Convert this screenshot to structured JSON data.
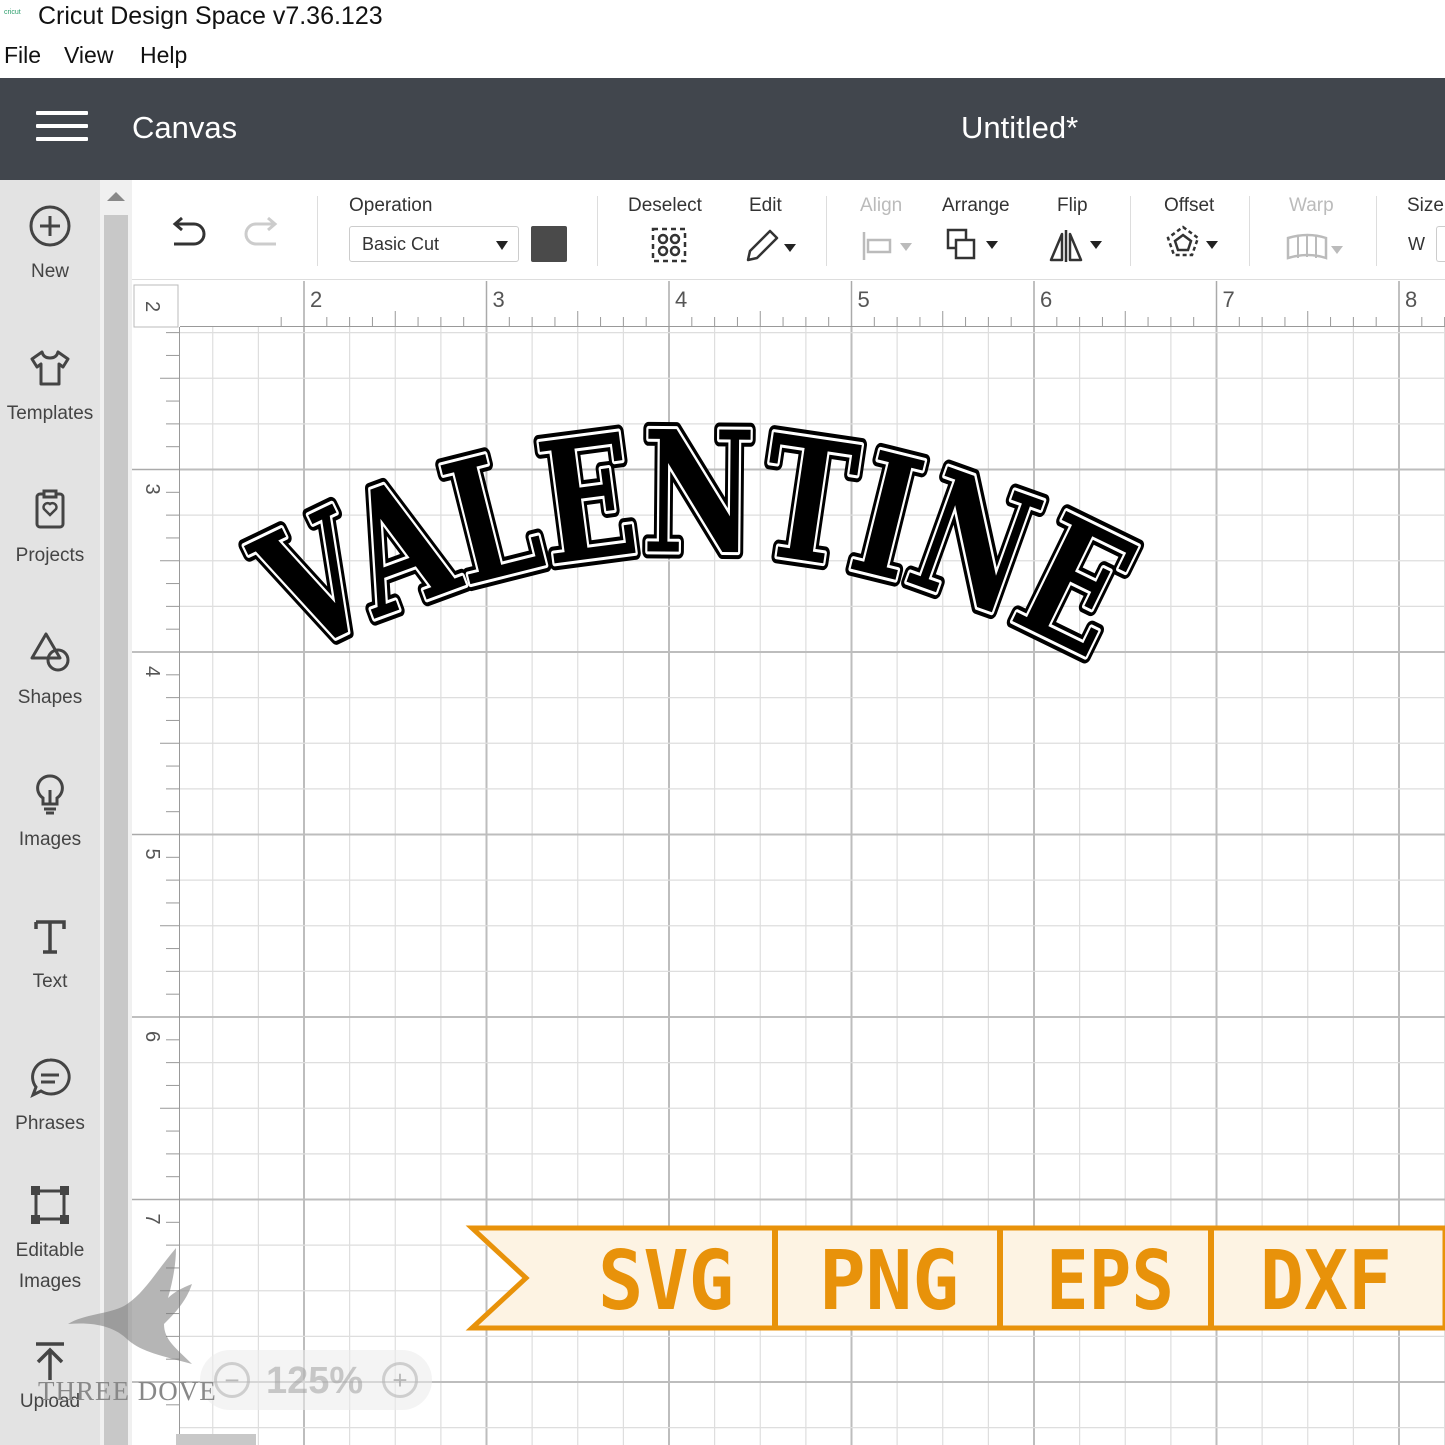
{
  "app": {
    "title": "Cricut Design Space  v7.36.123",
    "icon_text": "cricut"
  },
  "menu": [
    "File",
    "View",
    "Help"
  ],
  "header": {
    "section": "Canvas",
    "document_title": "Untitled*"
  },
  "sidebar": {
    "items": [
      {
        "label": "New",
        "icon": "plus-circle-icon"
      },
      {
        "label": "Templates",
        "icon": "tshirt-icon"
      },
      {
        "label": "Projects",
        "icon": "projects-icon"
      },
      {
        "label": "Shapes",
        "icon": "shapes-icon"
      },
      {
        "label": "Images",
        "icon": "lightbulb-icon"
      },
      {
        "label": "Text",
        "icon": "text-icon"
      },
      {
        "label": "Phrases",
        "icon": "phrases-icon"
      },
      {
        "label": "Editable\nImages",
        "icon": "editable-images-icon"
      },
      {
        "label": "Upload",
        "icon": "upload-icon"
      }
    ]
  },
  "toolbar": {
    "operation_label": "Operation",
    "operation_value": "Basic Cut",
    "deselect_label": "Deselect",
    "edit_label": "Edit",
    "align_label": "Align",
    "arrange_label": "Arrange",
    "flip_label": "Flip",
    "offset_label": "Offset",
    "warp_label": "Warp",
    "size_label": "Size",
    "size_w_label": "W",
    "swatch_color": "#4a4a4a"
  },
  "rulers": {
    "top": [
      "2",
      "3",
      "4",
      "5",
      "6",
      "7",
      "8"
    ],
    "left": [
      "2",
      "3",
      "4",
      "5",
      "6",
      "7"
    ]
  },
  "canvas": {
    "design_text": "VALENTINE",
    "banner": {
      "formats": [
        "SVG",
        "PNG",
        "EPS",
        "DXF"
      ],
      "color": "#e8920a",
      "fill": "#fdf3e3"
    }
  },
  "zoom": {
    "value": "125%",
    "minus": "−",
    "plus": "+"
  },
  "watermark": "THREE DOVE"
}
